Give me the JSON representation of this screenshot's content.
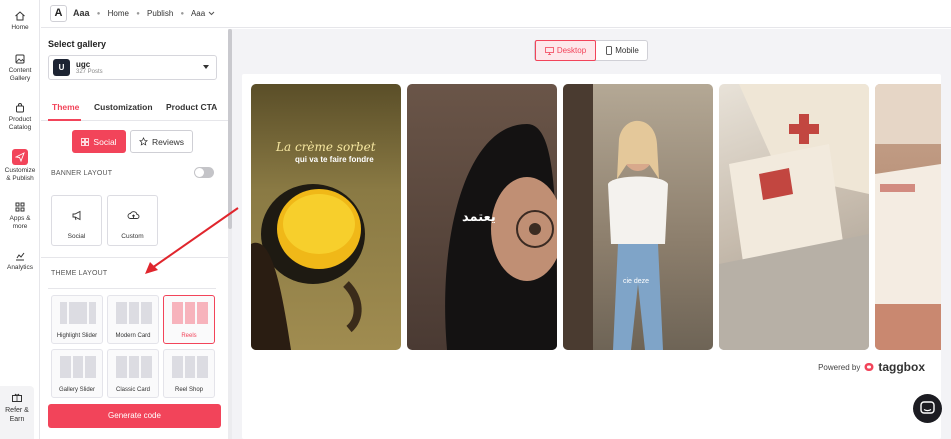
{
  "rail": {
    "items": [
      {
        "label": "Home",
        "icon": "home-icon"
      },
      {
        "label": "Content Gallery",
        "icon": "gallery-icon"
      },
      {
        "label": "Product Catalog",
        "icon": "bag-icon"
      },
      {
        "label": "Customize & Publish",
        "icon": "send-icon",
        "active": true
      },
      {
        "label": "Apps & more",
        "icon": "apps-icon"
      },
      {
        "label": "Analytics",
        "icon": "analytics-icon"
      }
    ],
    "bottom_label": "Refer & Earn",
    "active_color": "#f2445a"
  },
  "header": {
    "logo_letter": "A",
    "app_name": "Aaa",
    "crumbs": [
      "Home",
      "Publish"
    ],
    "current": "Aaa"
  },
  "panel": {
    "select_title": "Select gallery",
    "gallery": {
      "avatar": "U",
      "name": "ugc",
      "count": "327 Posts"
    },
    "tabs": [
      "Theme",
      "Customization",
      "Product CTA"
    ],
    "segments": {
      "social": "Social",
      "reviews": "Reviews"
    },
    "banner_layout": {
      "label": "BANNER LAYOUT",
      "toggle_on": false,
      "options": [
        "Social",
        "Custom"
      ]
    },
    "theme_layout": {
      "label": "THEME LAYOUT",
      "options": [
        "Highlight Slider",
        "Modern Card",
        "Reels",
        "Gallery Slider",
        "Classic Card",
        "Reel Shop"
      ],
      "selected": "Reels"
    },
    "generate_label": "Generate code"
  },
  "main": {
    "view": {
      "desktop": "Desktop",
      "mobile": "Mobile",
      "selected": "Desktop"
    },
    "tiles": [
      {
        "caption_line1": "La crème sorbet",
        "caption_line2": "qui va te faire fondre",
        "bg": "#7a6a3a"
      },
      {
        "caption": "يعتمد",
        "bg": "#3a2a26"
      },
      {
        "caption": "cie deze",
        "bg": "#8f8272"
      },
      {
        "caption": "",
        "bg": "#cdc3b6"
      },
      {
        "caption": "",
        "bg": "#b99a84"
      }
    ],
    "powered_by": "Powered by",
    "brand": "taggbox"
  }
}
